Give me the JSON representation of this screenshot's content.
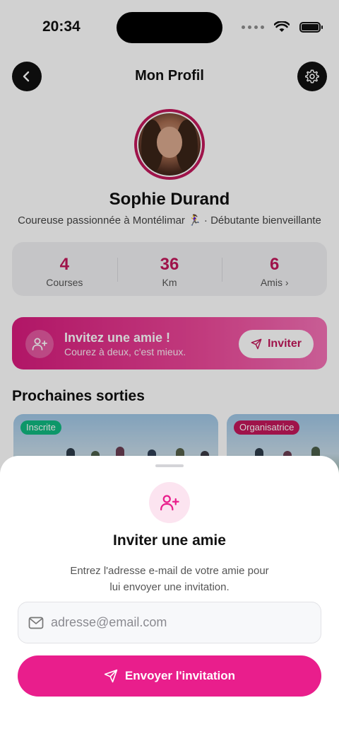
{
  "status_bar": {
    "time": "20:34"
  },
  "header": {
    "title": "Mon Profil"
  },
  "profile": {
    "name": "Sophie Durand",
    "bio": "Coureuse passionnée à Montélimar 🏃‍♀️ · Débutante bienveillante"
  },
  "stats": [
    {
      "value": "4",
      "label": "Courses"
    },
    {
      "value": "36",
      "label": "Km"
    },
    {
      "value": "6",
      "label": "Amis ›"
    }
  ],
  "invite_banner": {
    "title": "Invitez une amie !",
    "subtitle": "Courez à deux, c'est mieux.",
    "button_label": "Inviter"
  },
  "upcoming": {
    "section_title": "Prochaines sorties",
    "cards": [
      {
        "badge": "Inscrite",
        "badge_color": "#10b981"
      },
      {
        "badge": "Organisatrice",
        "badge_color": "#c2185b"
      }
    ]
  },
  "sheet": {
    "title": "Inviter une amie",
    "description": "Entrez l'adresse e-mail de votre amie pour lui envoyer une invitation.",
    "email_placeholder": "adresse@email.com",
    "email_value": "",
    "submit_label": "Envoyer l'invitation"
  },
  "colors": {
    "accent": "#e91e8c",
    "brand": "#c2185b",
    "success": "#10b981"
  },
  "icons": {
    "back": "chevron-left-icon",
    "settings": "gear-icon",
    "invite": "user-plus-icon",
    "send": "send-icon",
    "email": "mail-icon"
  }
}
